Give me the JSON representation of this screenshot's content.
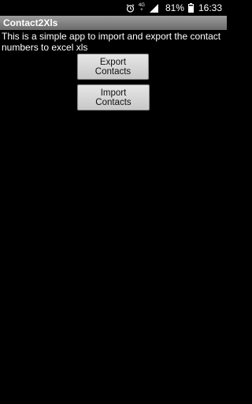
{
  "status_bar": {
    "network_label_top": "4G",
    "network_label_bottom": "+",
    "battery_percent": "81%",
    "time": "16:33",
    "icons": [
      "alarm-icon",
      "network-icon",
      "signal-icon",
      "battery-icon"
    ]
  },
  "app": {
    "title": "Contact2Xls"
  },
  "main": {
    "description": "This is a simple app to import and export the contact numbers to excel xls",
    "export_button": "Export Contacts",
    "import_button": "Import Contacts"
  },
  "colors": {
    "background": "#000000",
    "title_bar": "#8a8a8a",
    "button": "#d8d8d8",
    "text": "#ffffff"
  }
}
